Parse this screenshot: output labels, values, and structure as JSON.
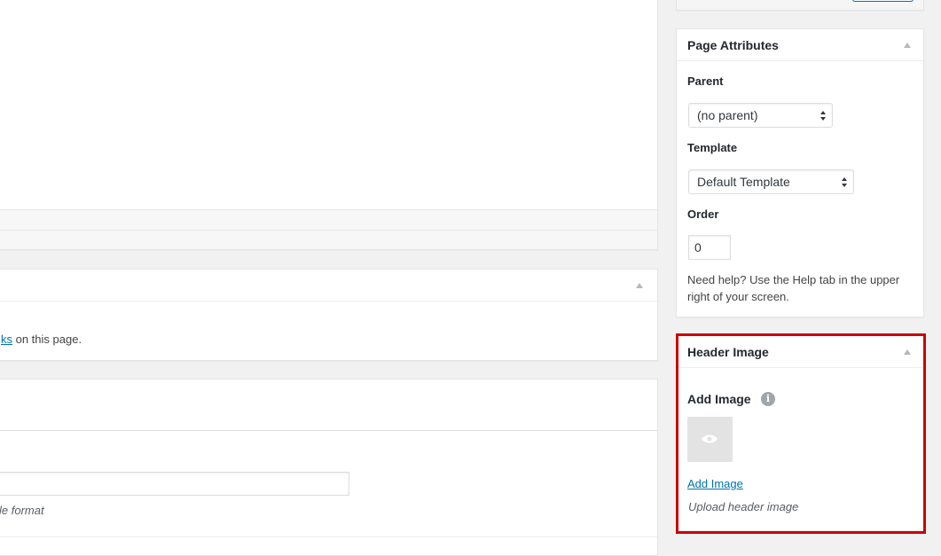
{
  "left": {
    "partial_link_text": "ks",
    "partial_after_link": " on this page.",
    "partial_desc": "le format"
  },
  "page_attributes": {
    "title": "Page Attributes",
    "parent_label": "Parent",
    "parent_value": "(no parent)",
    "template_label": "Template",
    "template_value": "Default Template",
    "order_label": "Order",
    "order_value": "0",
    "help_text": "Need help? Use the Help tab in the upper right of your screen."
  },
  "header_image": {
    "title": "Header Image",
    "add_image_label": "Add Image",
    "info_icon": "info-icon",
    "preview_icon": "eye-icon",
    "add_image_link": "Add Image",
    "upload_description": "Upload header image",
    "highlight_color": "#cc0000"
  },
  "colors": {
    "link": "#0073aa",
    "background": "#f1f1f1",
    "box_border": "#e5e5e5"
  }
}
